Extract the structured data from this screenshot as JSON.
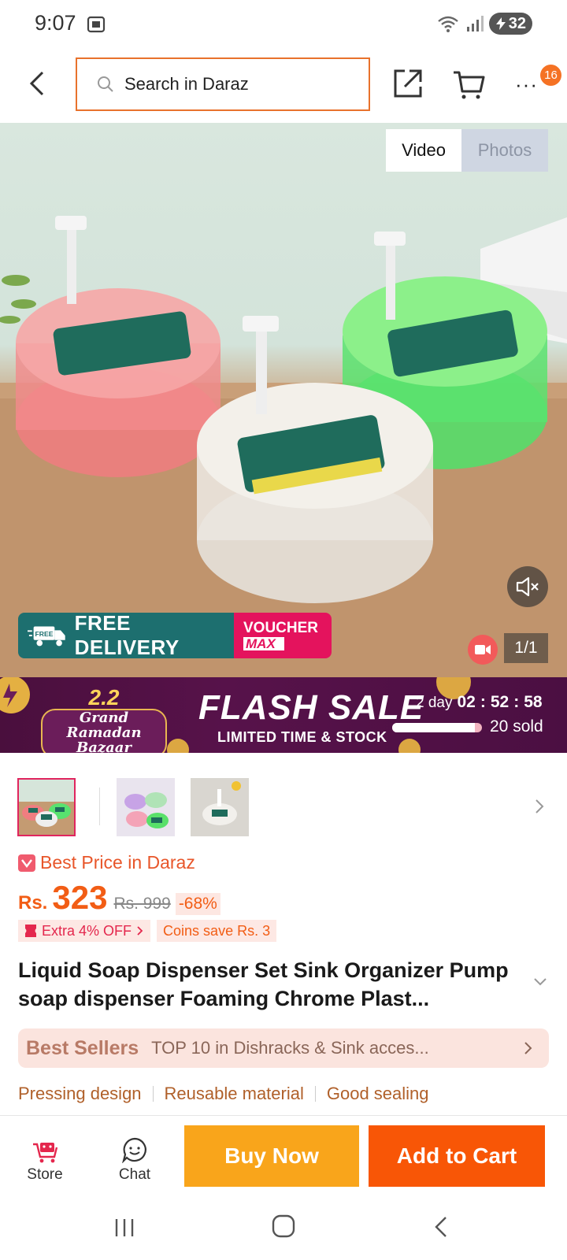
{
  "status_bar": {
    "time": "9:07",
    "battery": "32"
  },
  "header": {
    "search_placeholder": "Search in Daraz",
    "cart_badge": "16"
  },
  "gallery": {
    "tabs": {
      "video": "Video",
      "photos": "Photos"
    },
    "free_badge": "FREE",
    "free_delivery": "FREE DELIVERY",
    "voucher_line1": "VOUCHER",
    "voucher_line2": "MAX",
    "counter": "1/1"
  },
  "flash_sale": {
    "event_number": "2.2",
    "event_name_line1": "Grand Ramadan",
    "event_name_line2": "Bazaar",
    "title": "FLASH SALE",
    "subtitle": "LIMITED TIME & STOCK",
    "days": "2 day",
    "hours": "02",
    "minutes": "52",
    "seconds": "58",
    "sold_fraction": 0.92,
    "sold_text": "20 sold"
  },
  "product": {
    "best_price": "Best Price in Daraz",
    "currency": "Rs.",
    "price": "323",
    "old_price": "Rs. 999",
    "discount": "-68%",
    "extra_off": "Extra 4% OFF",
    "coins": "Coins save Rs. 3",
    "title": "Liquid Soap Dispenser Set Sink Organizer Pump soap dispenser Foaming Chrome Plast...",
    "best_sellers_logo": "Best Sellers",
    "best_sellers_text": "TOP 10 in Dishracks & Sink acces...",
    "features": [
      "Pressing design",
      "Reusable material",
      "Good sealing"
    ]
  },
  "bottom_bar": {
    "store": "Store",
    "chat": "Chat",
    "buy_now": "Buy Now",
    "add_to_cart": "Add to Cart"
  },
  "colors": {
    "accent": "#f85606",
    "buy_now": "#f9a51b",
    "flash_bg": "#4a0f3d",
    "delivery": "#1d6f6f",
    "voucher": "#e4135d"
  }
}
